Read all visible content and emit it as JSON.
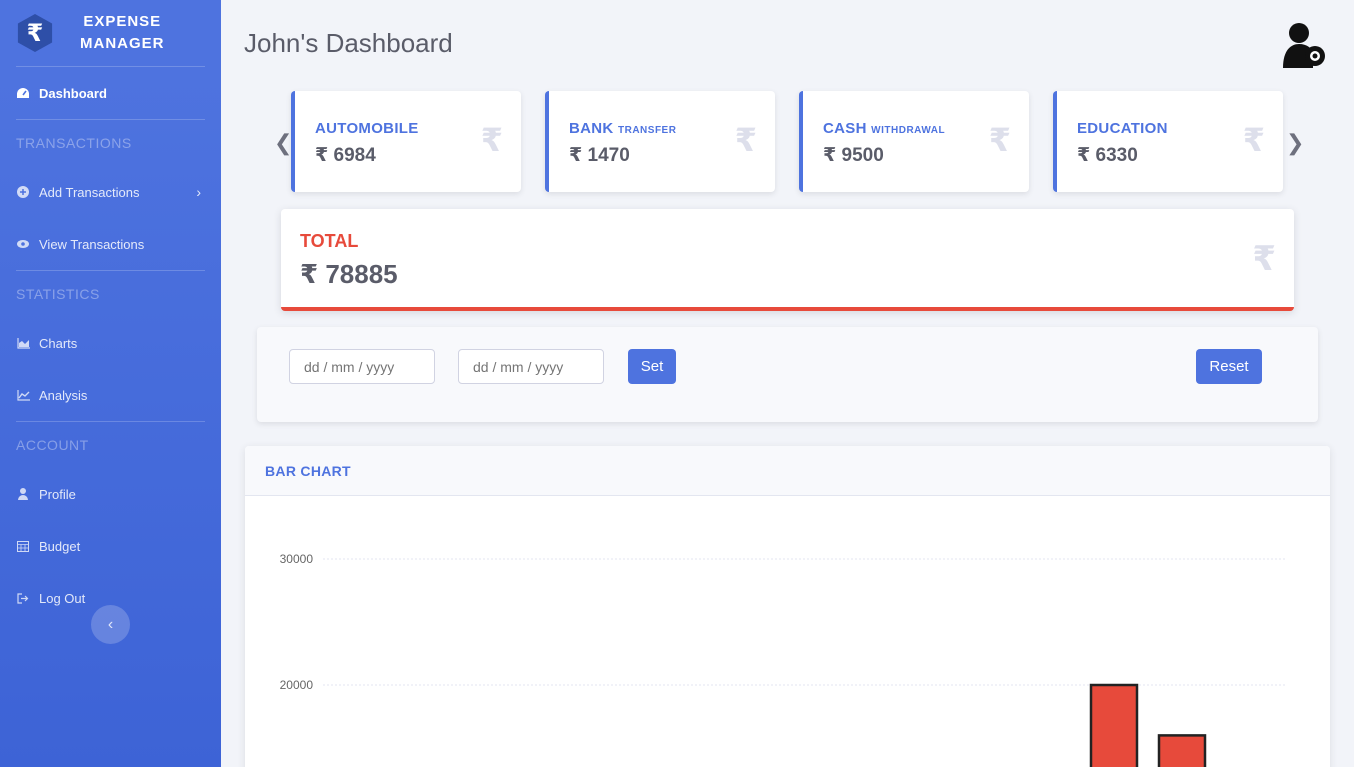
{
  "sidebar": {
    "brand_line1": "EXPENSE",
    "brand_line2": "MANAGER",
    "brand_symbol": "₹",
    "items": {
      "dashboard": "Dashboard",
      "transactions_heading": "TRANSACTIONS",
      "add_transactions": "Add Transactions",
      "view_transactions": "View Transactions",
      "statistics_heading": "STATISTICS",
      "charts": "Charts",
      "analysis": "Analysis",
      "account_heading": "ACCOUNT",
      "profile": "Profile",
      "budget": "Budget",
      "logout": "Log Out"
    }
  },
  "header": {
    "title": "John's Dashboard"
  },
  "cards": [
    {
      "label": "AUTOMOBILE",
      "sub": "",
      "value": "₹ 6984"
    },
    {
      "label": "BANK",
      "sub": "TRANSFER",
      "value": "₹ 1470"
    },
    {
      "label": "CASH",
      "sub": "WITHDRAWAL",
      "value": "₹ 9500"
    },
    {
      "label": "EDUCATION",
      "sub": "",
      "value": "₹ 6330"
    }
  ],
  "rupee_symbol": "₹",
  "total": {
    "label": "TOTAL",
    "value": "₹ 78885"
  },
  "filter": {
    "start_placeholder": "dd / mm / yyyy",
    "end_placeholder": "dd / mm / yyyy",
    "set_label": "Set",
    "reset_label": "Reset"
  },
  "chart_title": "BAR CHART",
  "colors": {
    "primary": "#4e73df",
    "danger": "#e74a3b"
  },
  "chart_data": {
    "type": "bar",
    "title": "BAR CHART",
    "yticks": [
      20000,
      30000
    ],
    "values": [
      20000,
      16000
    ],
    "grid": true
  }
}
